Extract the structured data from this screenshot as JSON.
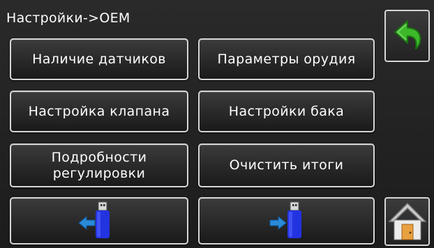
{
  "header": {
    "title": "Настройки->OEM"
  },
  "buttons": {
    "sensors": "Наличие датчиков",
    "implement_params": "Параметры орудия",
    "valve_setup": "Настройка клапана",
    "tank_setup": "Настройки бака",
    "regulation_details_line1": "Подробности",
    "regulation_details_line2": "регулировки",
    "clear_totals": "Очистить итоги"
  },
  "icons": {
    "usb_import": "usb-import-icon",
    "usb_export": "usb-export-icon",
    "back": "back-arrow-icon",
    "home": "home-icon"
  },
  "colors": {
    "background": "#1f1f1f",
    "button_border": "#d6d6d6",
    "text": "#ffffff",
    "usb_blue": "#2233e0",
    "arrow_blue": "#2a8ad8",
    "back_arrow_green": "#3cb82a",
    "home_orange": "#e8a040"
  }
}
